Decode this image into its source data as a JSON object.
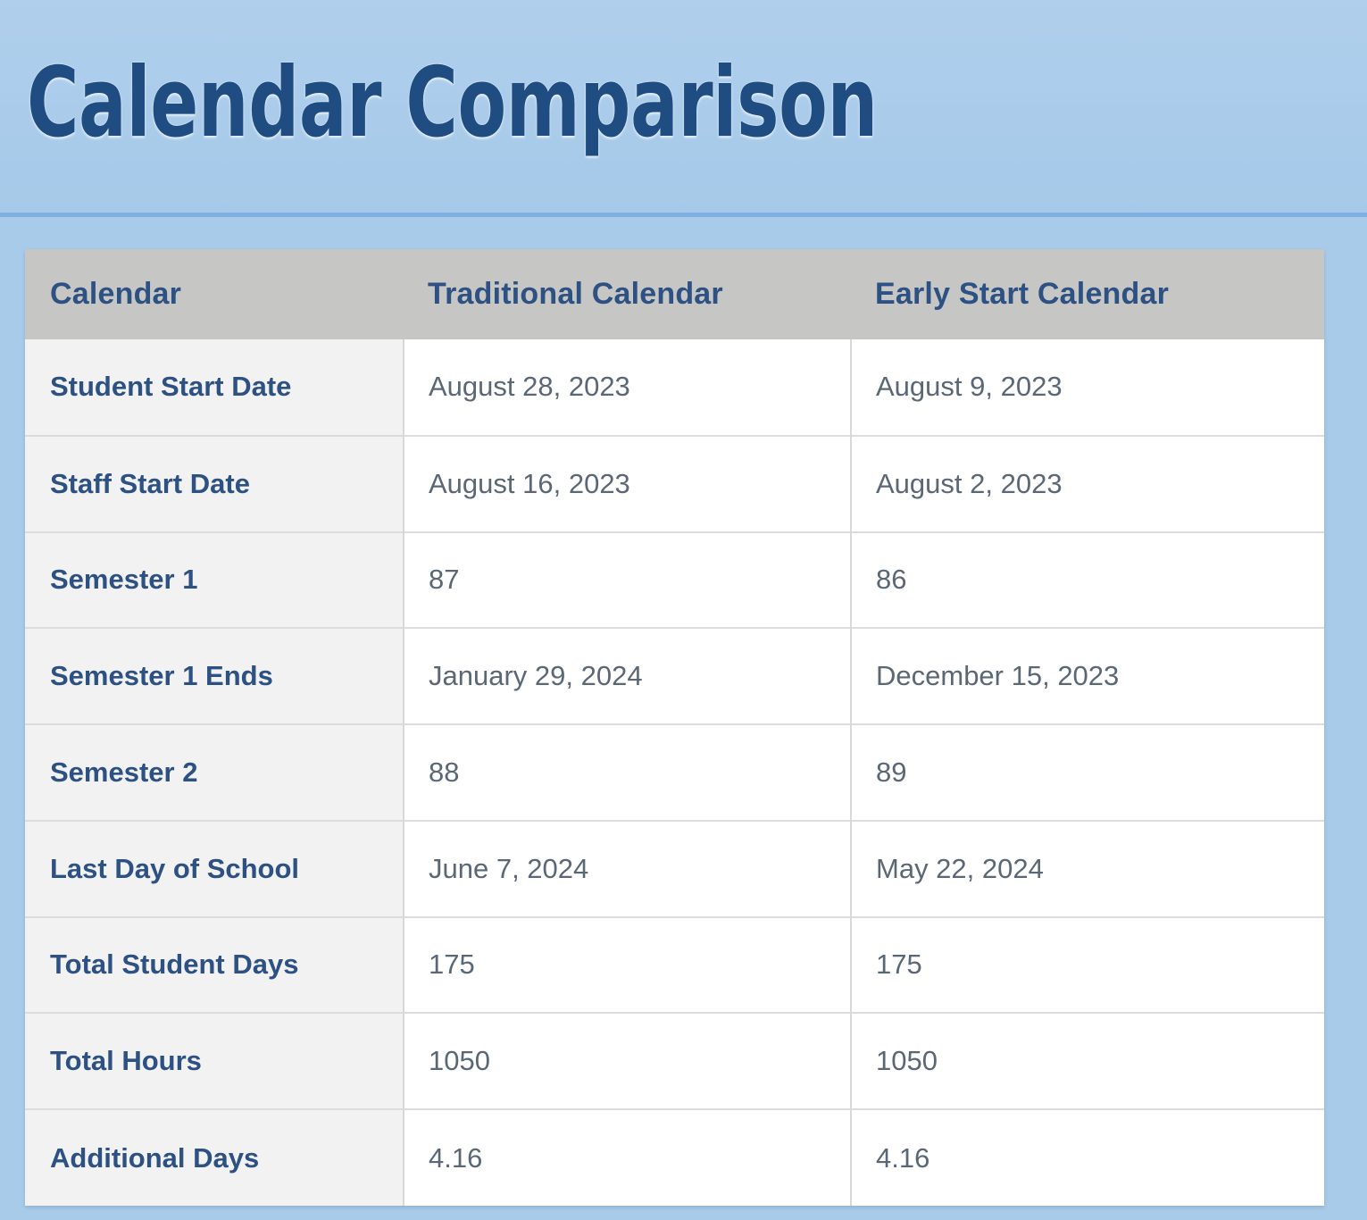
{
  "header": {
    "title": "Calendar Comparison"
  },
  "colors": {
    "page_background": "#a9cbea",
    "title_text": "#1f4d82",
    "title_rule": "#7cb0e0",
    "table_header_background": "#c6c6c4",
    "table_header_text": "#2d5183",
    "label_cell_background": "#f2f2f2",
    "label_text": "#2d5183",
    "value_text": "#5b6775",
    "value_cell_background": "#ffffff",
    "row_divider": "#dcdcdc"
  },
  "table": {
    "columns": [
      "Calendar",
      "Traditional Calendar",
      "Early Start Calendar"
    ],
    "rows": [
      {
        "label": "Student Start Date",
        "traditional": "August 28, 2023",
        "early_start": "August 9, 2023"
      },
      {
        "label": "Staff Start Date",
        "traditional": "August 16, 2023",
        "early_start": "August 2, 2023"
      },
      {
        "label": "Semester 1",
        "traditional": "87",
        "early_start": "86"
      },
      {
        "label": "Semester 1 Ends",
        "traditional": "January 29, 2024",
        "early_start": "December 15, 2023"
      },
      {
        "label": "Semester 2",
        "traditional": "88",
        "early_start": "89"
      },
      {
        "label": "Last Day of School",
        "traditional": "June 7, 2024",
        "early_start": "May 22, 2024"
      },
      {
        "label": "Total Student Days",
        "traditional": "175",
        "early_start": "175"
      },
      {
        "label": "Total Hours",
        "traditional": "1050",
        "early_start": "1050"
      },
      {
        "label": "Additional Days",
        "traditional": "4.16",
        "early_start": "4.16"
      }
    ]
  }
}
